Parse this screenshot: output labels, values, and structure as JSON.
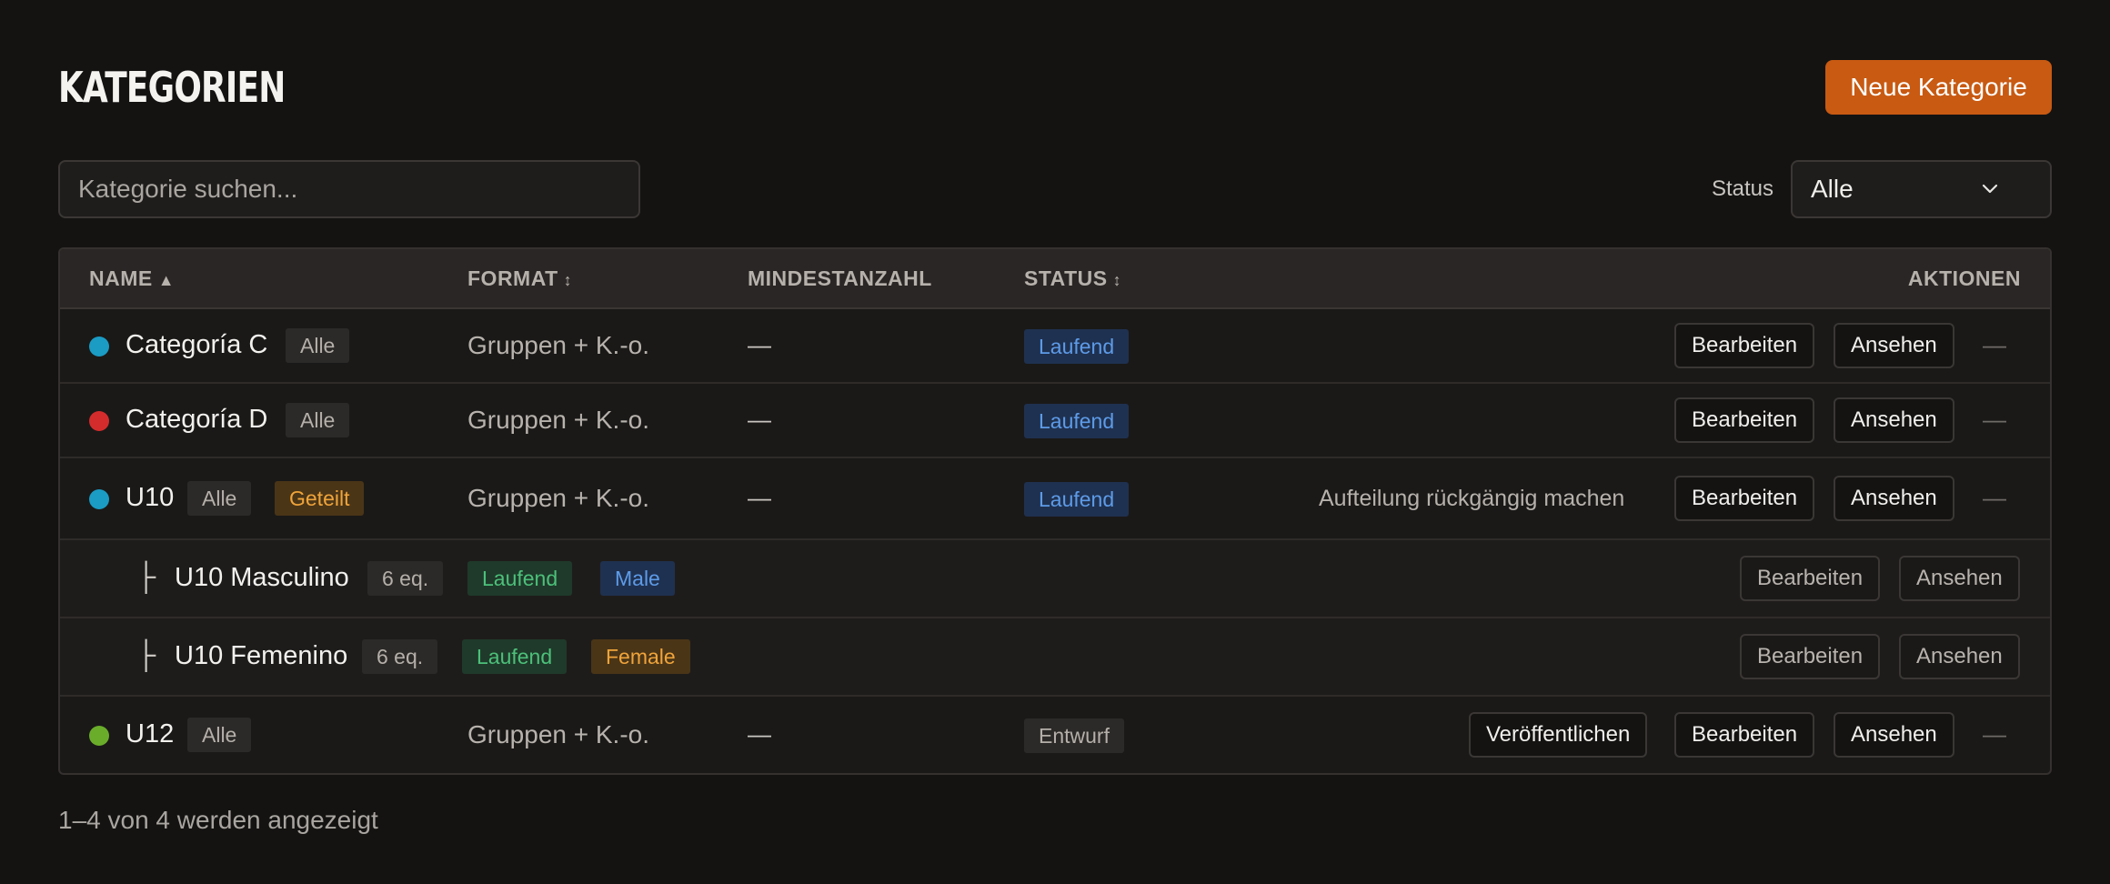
{
  "header": {
    "title": "KATEGORIEN",
    "new_button": "Neue Kategorie"
  },
  "search": {
    "placeholder": "Kategorie suchen..."
  },
  "filter": {
    "label": "Status",
    "value": "Alle"
  },
  "table": {
    "columns": {
      "name": "NAME",
      "name_sort": "▲",
      "format": "FORMAT",
      "format_sort": "↕",
      "min": "MINDESTANZAHL",
      "status": "STATUS",
      "status_sort": "↕",
      "actions": "AKTIONEN"
    },
    "rows": [
      {
        "name": "Categoría C",
        "dot_color": "#1a9cc4",
        "tag": "Alle",
        "format": "Gruppen + K.-o.",
        "min": "—",
        "status": "Laufend",
        "edit": "Bearbeiten",
        "view": "Ansehen",
        "more": "—"
      },
      {
        "name": "Categoría D",
        "dot_color": "#d42c2c",
        "tag": "Alle",
        "format": "Gruppen + K.-o.",
        "min": "—",
        "status": "Laufend",
        "edit": "Bearbeiten",
        "view": "Ansehen",
        "more": "—"
      },
      {
        "name": "U10",
        "dot_color": "#1a9cc4",
        "tag": "Alle",
        "tag2": "Geteilt",
        "format": "Gruppen + K.-o.",
        "min": "—",
        "status": "Laufend",
        "undo": "Aufteilung rückgängig machen",
        "edit": "Bearbeiten",
        "view": "Ansehen",
        "more": "—"
      },
      {
        "tree": "├",
        "name": "U10 Masculino",
        "teams": "6 eq.",
        "status": "Laufend",
        "gender": "Male",
        "edit": "Bearbeiten",
        "view": "Ansehen"
      },
      {
        "tree": "├",
        "name": "U10 Femenino",
        "teams": "6 eq.",
        "status": "Laufend",
        "gender": "Female",
        "edit": "Bearbeiten",
        "view": "Ansehen"
      },
      {
        "name": "U12",
        "dot_color": "#6aad2a",
        "tag": "Alle",
        "format": "Gruppen + K.-o.",
        "min": "—",
        "status": "Entwurf",
        "publish": "Veröffentlichen",
        "edit": "Bearbeiten",
        "view": "Ansehen",
        "more": "—"
      }
    ]
  },
  "footer": {
    "count": "1–4 von 4 werden angezeigt"
  },
  "colors": {
    "accent": "#c85a12",
    "background": "#141312"
  }
}
